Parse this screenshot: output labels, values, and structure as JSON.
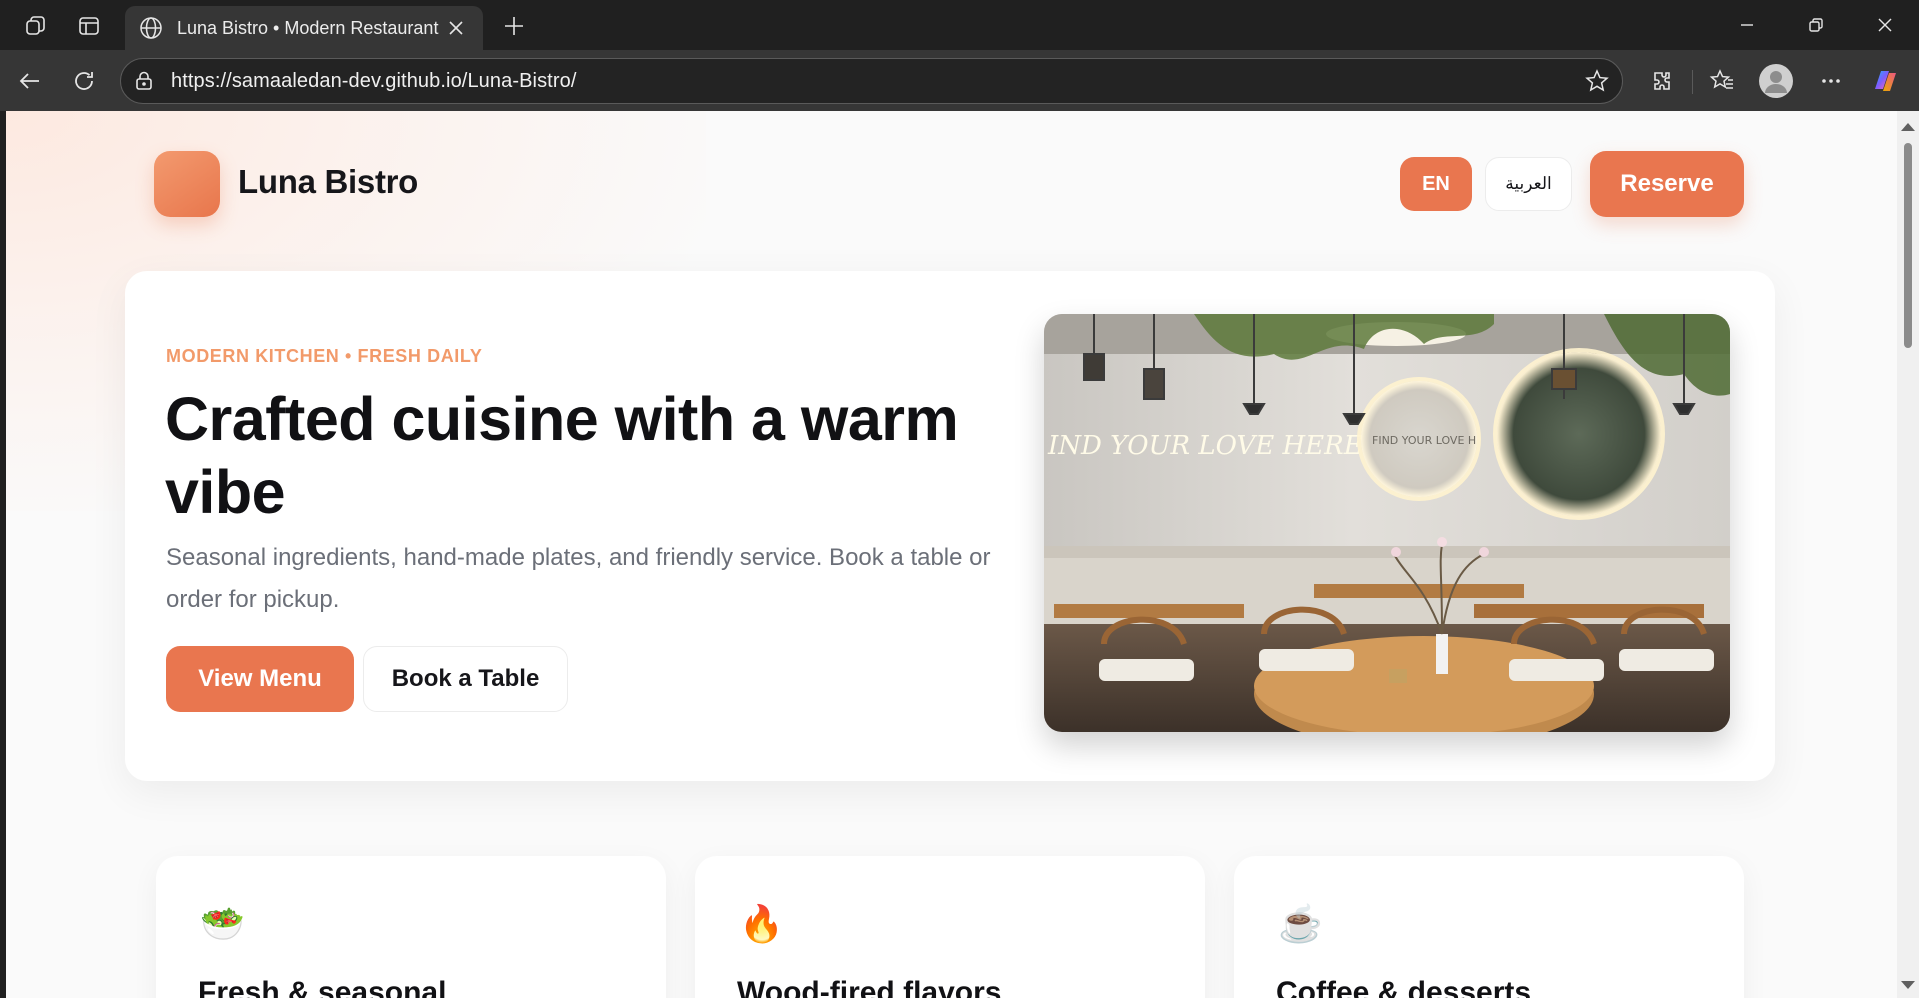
{
  "browser": {
    "tab_title": "Luna Bistro • Modern Restaurant",
    "url": "https://samaaledan-dev.github.io/Luna-Bistro/"
  },
  "site": {
    "brand": "Luna Bistro",
    "lang_en": "EN",
    "lang_ar": "العربية",
    "reserve_label": "Reserve"
  },
  "hero": {
    "eyebrow": "MODERN KITCHEN • FRESH DAILY",
    "headline": "Crafted cuisine with a warm vibe",
    "lede": "Seasonal ingredients, hand-made plates, and friendly service. Book a table or order for pickup.",
    "primary_cta": "View Menu",
    "secondary_cta": "Book a Table",
    "image_sign_text": "IND YOUR LOVE HERE",
    "image_mirror_text": "FIND YOUR LOVE H"
  },
  "features": [
    {
      "emoji": "🥗",
      "title": "Fresh & seasonal"
    },
    {
      "emoji": "🔥",
      "title": "Wood-fired flavors"
    },
    {
      "emoji": "☕",
      "title": "Coffee & desserts"
    }
  ],
  "colors": {
    "accent": "#e9764f",
    "eyebrow": "#f29a6a",
    "chrome_dark": "#202020",
    "chrome_mid": "#363636"
  }
}
